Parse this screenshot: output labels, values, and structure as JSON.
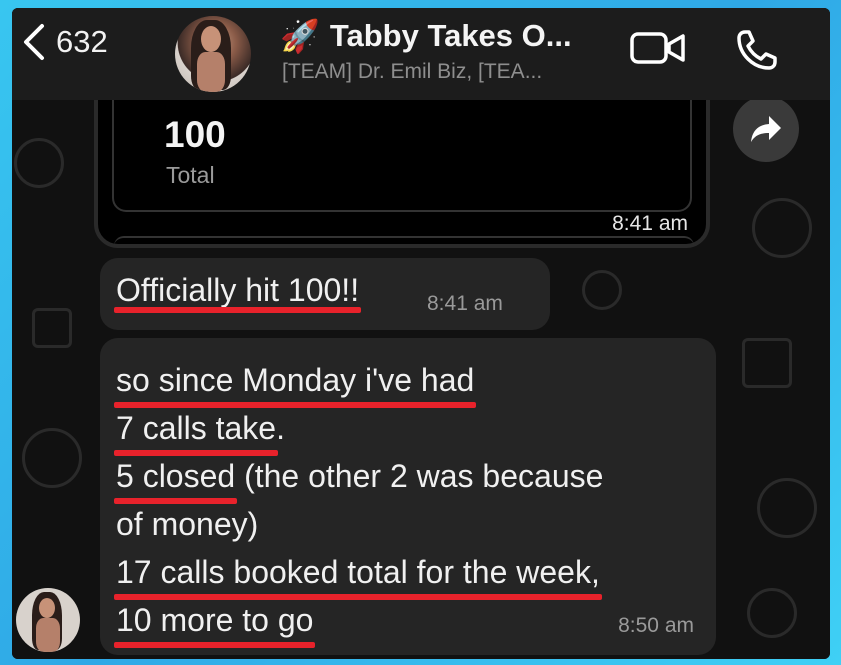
{
  "header": {
    "back_count": "632",
    "title_emoji": "🚀",
    "title": "Tabby Takes O...",
    "subtitle": "[TEAM] Dr. Emil Biz, [TEA...",
    "icons": [
      "chevron-left-icon",
      "video-call-icon",
      "phone-call-icon"
    ]
  },
  "card": {
    "value": "100",
    "label": "Total",
    "time": "8:41 am"
  },
  "messages": [
    {
      "text": "Officially hit 100!!",
      "time": "8:41 am"
    },
    {
      "lines": [
        "so since Monday i've had",
        "7 calls take",
        ".",
        "5 closed",
        " (the other 2 was because",
        "of money)",
        "17 calls booked total for the week,",
        "10 more to go"
      ],
      "time": "8:50 am"
    }
  ],
  "colors": {
    "underline": "#e8222b",
    "bubble": "#252525",
    "header": "#1c1c1c",
    "border": "#3fc4f0"
  }
}
